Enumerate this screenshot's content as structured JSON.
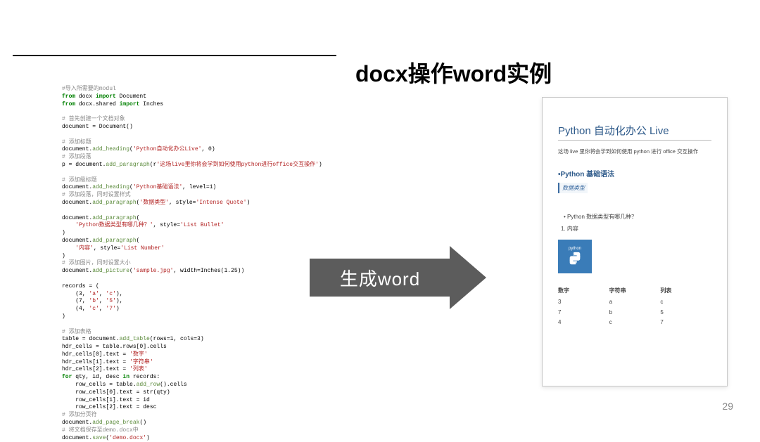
{
  "header": {
    "title": "docx操作word实例"
  },
  "arrow": {
    "label": "生成word"
  },
  "code": {
    "l1": "#导入所需要的modul",
    "l2a": "from",
    "l2b": " docx ",
    "l2c": "import",
    "l2d": " Document",
    "l3a": "from",
    "l3b": " docx.shared ",
    "l3c": "import",
    "l3d": " Inches",
    "l4": "# 首先创建一个文档对象",
    "l5": "document = Document()",
    "l6": "# 添加标题",
    "l7a": "document.",
    "l7b": "add_heading",
    "l7c": "(",
    "l7d": "'Python自动化办公Live'",
    "l7e": ", 0)",
    "l8": "# 添加段落",
    "l9a": "p = document.",
    "l9b": "add_paragraph",
    "l9c": "(r",
    "l9d": "'这场live里你将会学到如何使用python进行office交互操作'",
    "l9e": ")",
    "l10": "# 添加级标题",
    "l11a": "document.",
    "l11b": "add_heading",
    "l11c": "(",
    "l11d": "'Python基础语法'",
    "l11e": ", level=1)",
    "l12": "# 添加段落，同时设置样式",
    "l13a": "document.",
    "l13b": "add_paragraph",
    "l13c": "(",
    "l13d": "'数据类型'",
    "l13e": ", style=",
    "l13f": "'Intense Quote'",
    "l13g": ")",
    "l14a": "document.",
    "l14b": "add_paragraph",
    "l14c": "(",
    "l15a": "    ",
    "l15b": "'Python数据类型有哪几种？'",
    "l15c": ", style=",
    "l15d": "'List Bullet'",
    "l16": ")",
    "l17a": "document.",
    "l17b": "add_paragraph",
    "l17c": "(",
    "l18a": "    ",
    "l18b": "'内容'",
    "l18c": ", style=",
    "l18d": "'List Number'",
    "l19": ")",
    "l20": "# 添加图片，同时设置大小",
    "l21a": "document.",
    "l21b": "add_picture",
    "l21c": "(",
    "l21d": "'sample.jpg'",
    "l21e": ", width=Inches(1.25))",
    "l22": "records = (",
    "l23a": "    (3, ",
    "l23b": "'a'",
    "l23c": ", ",
    "l23d": "'c'",
    "l23e": "),",
    "l24a": "    (7, ",
    "l24b": "'b'",
    "l24c": ", ",
    "l24d": "'5'",
    "l24e": "),",
    "l25a": "    (4, ",
    "l25b": "'c'",
    "l25c": ", ",
    "l25d": "'7'",
    "l25e": ")",
    "l26": ")",
    "l27": "# 添加表格",
    "l28a": "table = document.",
    "l28b": "add_table",
    "l28c": "(rows=1, cols=3)",
    "l29": "hdr_cells = table.rows[0].cells",
    "l30a": "hdr_cells[0].text = ",
    "l30b": "'数字'",
    "l31a": "hdr_cells[1].text = ",
    "l31b": "'字符串'",
    "l32a": "hdr_cells[2].text = ",
    "l32b": "'列表'",
    "l33a": "for",
    "l33b": " qty, id, desc ",
    "l33c": "in",
    "l33d": " records:",
    "l34a": "    row_cells = table.",
    "l34b": "add_row",
    "l34c": "().cells",
    "l35": "    row_cells[0].text = str(qty)",
    "l36": "    row_cells[1].text = id",
    "l37": "    row_cells[2].text = desc",
    "l38": "# 添加分页符",
    "l39a": "document.",
    "l39b": "add_page_break",
    "l39c": "()",
    "l40": "# 将文档保存至demo.docx中",
    "l41a": "document.",
    "l41b": "save",
    "l41c": "(",
    "l41d": "'demo.docx'",
    "l41e": ")"
  },
  "doc": {
    "title": "Python 自动化办公 Live",
    "para": "这场 live 里你将会学到如何使用 python 进行 office 交互操作",
    "h1": "Python 基础语法",
    "quote": "数据类型",
    "bullet": "• Python 数据类型有哪几种？",
    "num": "1.  内容",
    "img_label": "python",
    "table": {
      "headers": [
        "数字",
        "字符串",
        "列表"
      ],
      "rows": [
        [
          "3",
          "a",
          "c"
        ],
        [
          "7",
          "b",
          "5"
        ],
        [
          "4",
          "c",
          "7"
        ]
      ]
    }
  },
  "page_number": "29"
}
